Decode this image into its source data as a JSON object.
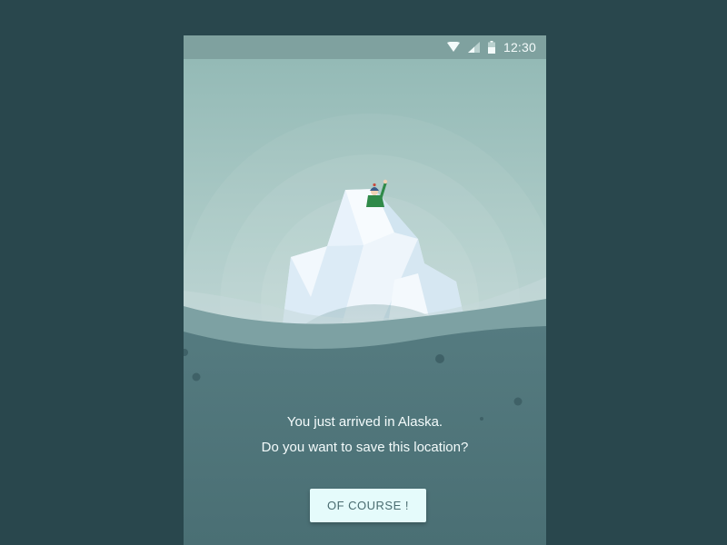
{
  "status_bar": {
    "time": "12:30",
    "icons": [
      "wifi-icon",
      "cell-signal-icon",
      "battery-icon"
    ]
  },
  "illustration": {
    "subject": "iceberg-with-waving-explorer",
    "colors": {
      "sky": "#97bdba",
      "ice": "#e6f2f8",
      "water": "#4f7479",
      "wave": "#6e9493"
    }
  },
  "dialog": {
    "line1": "You just arrived in Alaska.",
    "line2": "Do you want to save this location?",
    "button_label": "OF COURSE !"
  },
  "colors": {
    "background": "#29474d",
    "button_bg": "#e5fbfb",
    "button_text": "#4a6c70",
    "text": "#f3fbfb"
  }
}
